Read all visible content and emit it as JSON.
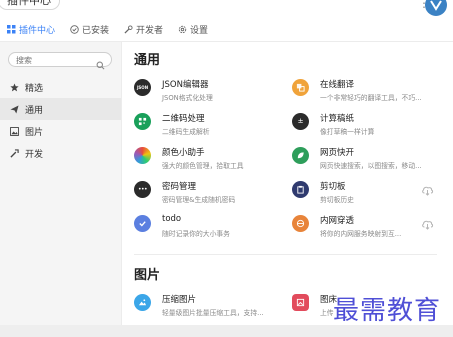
{
  "app": {
    "title": "插件中心",
    "menu": "⋮"
  },
  "tabs": [
    {
      "label": "插件中心",
      "icon": "grid-icon",
      "active": true
    },
    {
      "label": "已安装",
      "icon": "check-circle-icon",
      "active": false
    },
    {
      "label": "开发者",
      "icon": "wrench-icon",
      "active": false
    },
    {
      "label": "设置",
      "icon": "gear-icon",
      "active": false
    }
  ],
  "sidebar": {
    "search_placeholder": "搜索",
    "items": [
      {
        "label": "精选",
        "icon": "star-icon",
        "active": false
      },
      {
        "label": "通用",
        "icon": "send-icon",
        "active": true
      },
      {
        "label": "图片",
        "icon": "image-icon",
        "active": false
      },
      {
        "label": "开发",
        "icon": "tool-icon",
        "active": false
      }
    ]
  },
  "sections": [
    {
      "title": "通用",
      "plugins": [
        {
          "name": "JSON编辑器",
          "desc": "JSON格式化处理",
          "icon_text": "JSON",
          "color": "#2b2b2b"
        },
        {
          "name": "在线翻译",
          "desc": "一个非常轻巧的翻译工具，不巧...",
          "icon_text": "",
          "color": "#f0a33a"
        },
        {
          "name": "二维码处理",
          "desc": "二维码生成解析",
          "icon_text": "",
          "color": "#19a05a"
        },
        {
          "name": "计算稿纸",
          "desc": "像打草稿一样计算",
          "icon_text": "",
          "color": "#2b2b2b"
        },
        {
          "name": "颜色小助手",
          "desc": "强大的颜色管理，拾取工具",
          "icon_text": "",
          "color": "#e74c3c"
        },
        {
          "name": "网页快开",
          "desc": "网页快速搜索，以图搜索，移动...",
          "icon_text": "",
          "color": "#2e9e5b"
        },
        {
          "name": "密码管理",
          "desc": "密码管理&生成随机密码",
          "icon_text": "",
          "color": "#2b2b2b"
        },
        {
          "name": "剪切板",
          "desc": "剪切板历史",
          "icon_text": "",
          "color": "#2f3a6e"
        },
        {
          "name": "todo",
          "desc": "随时记录你的大小事务",
          "icon_text": "",
          "color": "#5b7fe0"
        },
        {
          "name": "内网穿透",
          "desc": "将你的内网服务映射到互...",
          "icon_text": "",
          "color": "#e8843a"
        }
      ]
    },
    {
      "title": "图片",
      "plugins": [
        {
          "name": "压缩图片",
          "desc": "轻量级图片批量压缩工具，支持...",
          "icon_text": "",
          "color": "#3ba6e8"
        },
        {
          "name": "图床",
          "desc": "上传",
          "icon_text": "",
          "color": "#e24b5c"
        }
      ]
    }
  ],
  "watermark": "最需教育",
  "colors": {
    "accent": "#3b82f6",
    "sidebar_bg": "#f5f5f5"
  }
}
